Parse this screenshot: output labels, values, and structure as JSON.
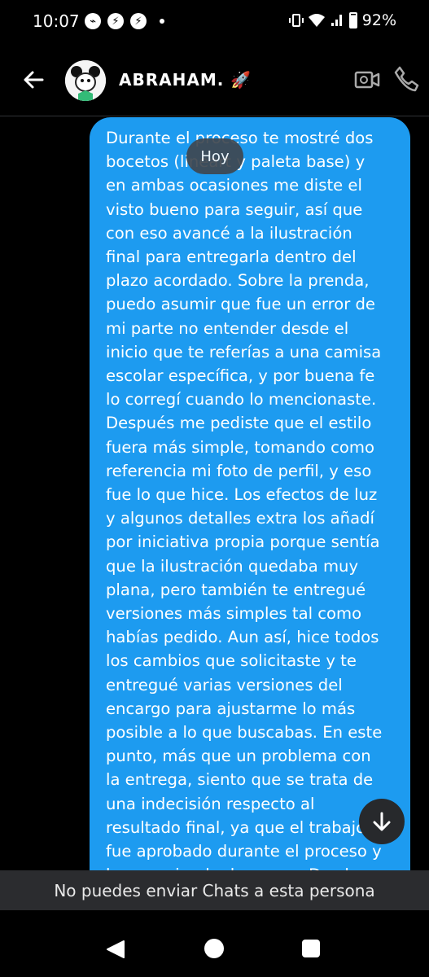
{
  "status_bar": {
    "time": "10:07",
    "battery": "92%",
    "left_icons": [
      "game-controller-icon",
      "messenger-icon",
      "messenger-icon"
    ],
    "right_icons": [
      "vibrate-icon",
      "wifi-icon",
      "signal-icon",
      "battery-icon"
    ]
  },
  "header": {
    "contact_name": "ABRAHAM. 🚀",
    "back_icon": "arrow-left-icon",
    "video_icon": "video-camera-icon",
    "call_icon": "phone-icon"
  },
  "conversation": {
    "date_chip": "Hoy",
    "message": "Durante el proceso te mostré dos\nbocetos (lineart y paleta base) y\nen ambas ocasiones me diste el\nvisto bueno para seguir, así que\ncon eso avancé a la ilustración\nfinal para entregarla dentro del\nplazo acordado. Sobre la prenda,\npuedo asumir que fue un error de\nmi parte no entender desde el\ninicio que te referías a una camisa\nescolar específica, y por buena fe\nlo corregí cuando lo mencionaste.\nDespués me pediste que el estilo\nfuera más simple, tomando como\nreferencia mi foto de perfil, y eso\nfue lo que hice. Los efectos de luz\ny algunos detalles extra los añadí\npor iniciativa propia porque sentía\nque la ilustración quedaba muy\nplana, pero también te entregué\nversiones más simples tal como\nhabías pedido. Aun así, hice todos\nlos cambios que solicitaste y te\nentregué varias versiones del\nencargo para ajustarme lo más\nposible a lo que buscabas. En este\npunto, más que un problema con\nla entrega, siento que se trata de\nuna indecisión respecto al\nresultado final, ya que el trabajo\nfue aprobado durante el proceso y\nlo recomiendo de nuevo. Desde",
    "bubble_color": "#1d9bf0"
  },
  "footer": {
    "blocked_notice": "No puedes enviar Chats a esta persona"
  },
  "nav_bar": {
    "icons": [
      "back-triangle-icon",
      "home-circle-icon",
      "recents-square-icon"
    ]
  }
}
